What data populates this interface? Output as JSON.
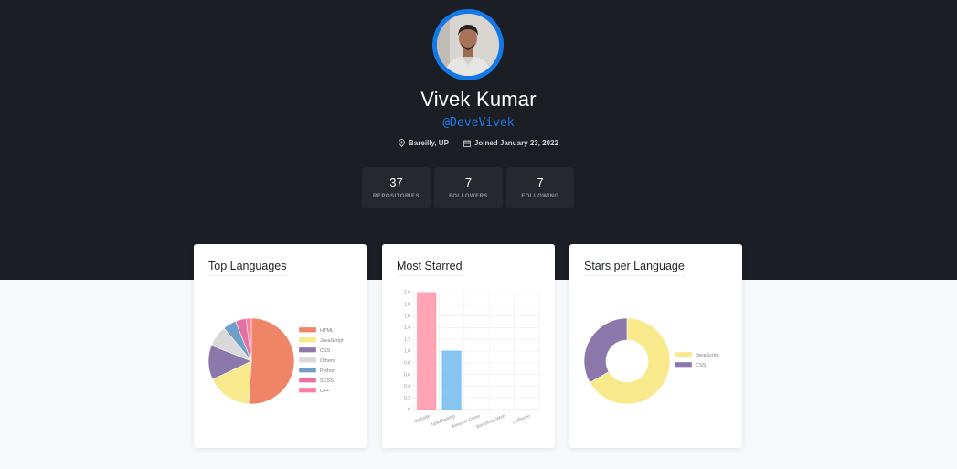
{
  "profile": {
    "name": "Vivek Kumar",
    "handle": "@DeveVivek",
    "location": "Bareilly, UP",
    "joined": "Joined January 23, 2022",
    "accent": "#1479e6"
  },
  "stats": [
    {
      "value": "37",
      "label": "REPOSITORIES"
    },
    {
      "value": "7",
      "label": "FOLLOWERS"
    },
    {
      "value": "7",
      "label": "FOLLOWING"
    }
  ],
  "cards": {
    "top_languages": "Top Languages",
    "most_starred": "Most Starred",
    "stars_per_language": "Stars per Language"
  },
  "icons": {
    "location": "map-pin-icon",
    "calendar": "calendar-icon"
  },
  "chart_data": [
    {
      "type": "pie",
      "title": "Top Languages",
      "legend_position": "right",
      "slices": [
        {
          "label": "HTML",
          "value": 51,
          "color": "#f08466"
        },
        {
          "label": "JavaScript",
          "value": 17,
          "color": "#f7e98c"
        },
        {
          "label": "CSS",
          "value": 13,
          "color": "#8c78ab"
        },
        {
          "label": "Others",
          "value": 8,
          "color": "#d9d9d9"
        },
        {
          "label": "Python",
          "value": 5,
          "color": "#6f9fc6"
        },
        {
          "label": "SCSS",
          "value": 4,
          "color": "#e670a1"
        },
        {
          "label": "C++",
          "value": 2,
          "color": "#f97ea1"
        }
      ]
    },
    {
      "type": "bar",
      "title": "Most Starred",
      "categories": [
        "Website",
        "TaskMarking",
        "Amazon-Clone",
        "Bootstrap-Web",
        "LetRemo"
      ],
      "values": [
        2,
        1,
        0,
        0,
        0
      ],
      "colors": [
        "#ff94a8",
        "#72bcef",
        "#f5cf72",
        "#7fd3c6",
        "#a88fe8"
      ],
      "ylim": [
        0,
        2
      ],
      "yticks": [
        "2.0",
        "1.8",
        "1.6",
        "1.4",
        "1.2",
        "1.0",
        "0.8",
        "0.6",
        "0.4",
        "0.2",
        "0"
      ],
      "grid": true
    },
    {
      "type": "pie",
      "subtype": "doughnut",
      "title": "Stars per Language",
      "legend_position": "right",
      "slices": [
        {
          "label": "JavaScript",
          "value": 2,
          "color": "#f7e98c"
        },
        {
          "label": "CSS",
          "value": 1,
          "color": "#8c78ab"
        }
      ]
    }
  ]
}
